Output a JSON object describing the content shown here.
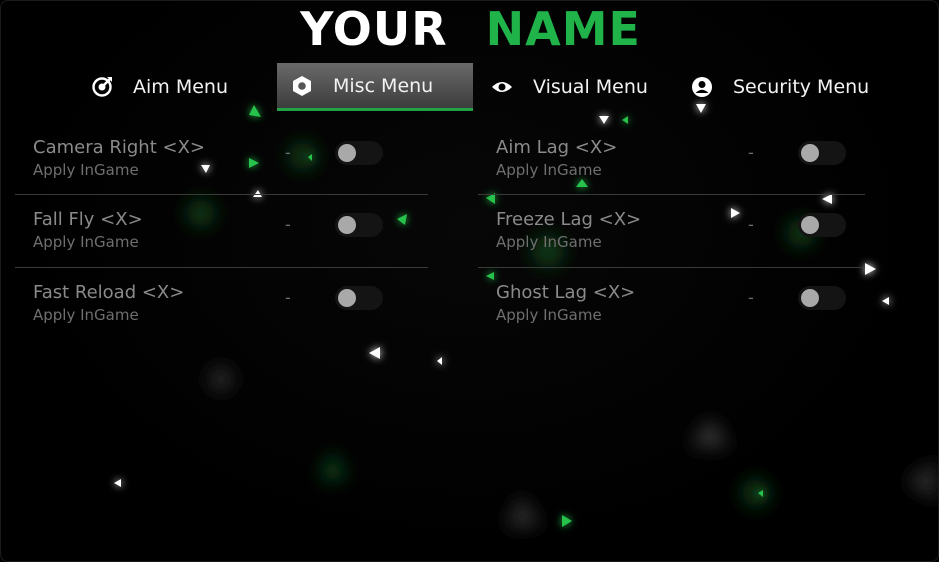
{
  "header": {
    "title_part1": "YOUR",
    "title_part2": "NAME"
  },
  "tabs": [
    {
      "label": "Aim Menu",
      "icon": "target-icon",
      "active": false
    },
    {
      "label": "Misc Menu",
      "icon": "hexagon-icon",
      "active": true
    },
    {
      "label": "Visual Menu",
      "icon": "eye-icon",
      "active": false
    },
    {
      "label": "Security Menu",
      "icon": "user-icon",
      "active": false
    }
  ],
  "left_column": [
    {
      "name": "Camera Right <X>",
      "sub": "Apply InGame",
      "separator": "-",
      "enabled": false
    },
    {
      "name": "Fall Fly <X>",
      "sub": "Apply InGame",
      "separator": "-",
      "enabled": false
    },
    {
      "name": "Fast Reload <X>",
      "sub": "Apply InGame",
      "separator": "-",
      "enabled": false
    }
  ],
  "right_column": [
    {
      "name": "Aim Lag <X>",
      "sub": "Apply InGame",
      "separator": "-",
      "enabled": false
    },
    {
      "name": "Freeze Lag <X>",
      "sub": "Apply InGame",
      "separator": "-",
      "enabled": false
    },
    {
      "name": "Ghost Lag <X>",
      "sub": "Apply InGame",
      "separator": "-",
      "enabled": false
    }
  ],
  "colors": {
    "accent": "#1fb34a",
    "background": "#000000",
    "text_primary": "#f2f2f2",
    "text_muted": "#8a8a8a",
    "toggle_off_track": "#141414",
    "toggle_knob": "#a9a9a9"
  }
}
